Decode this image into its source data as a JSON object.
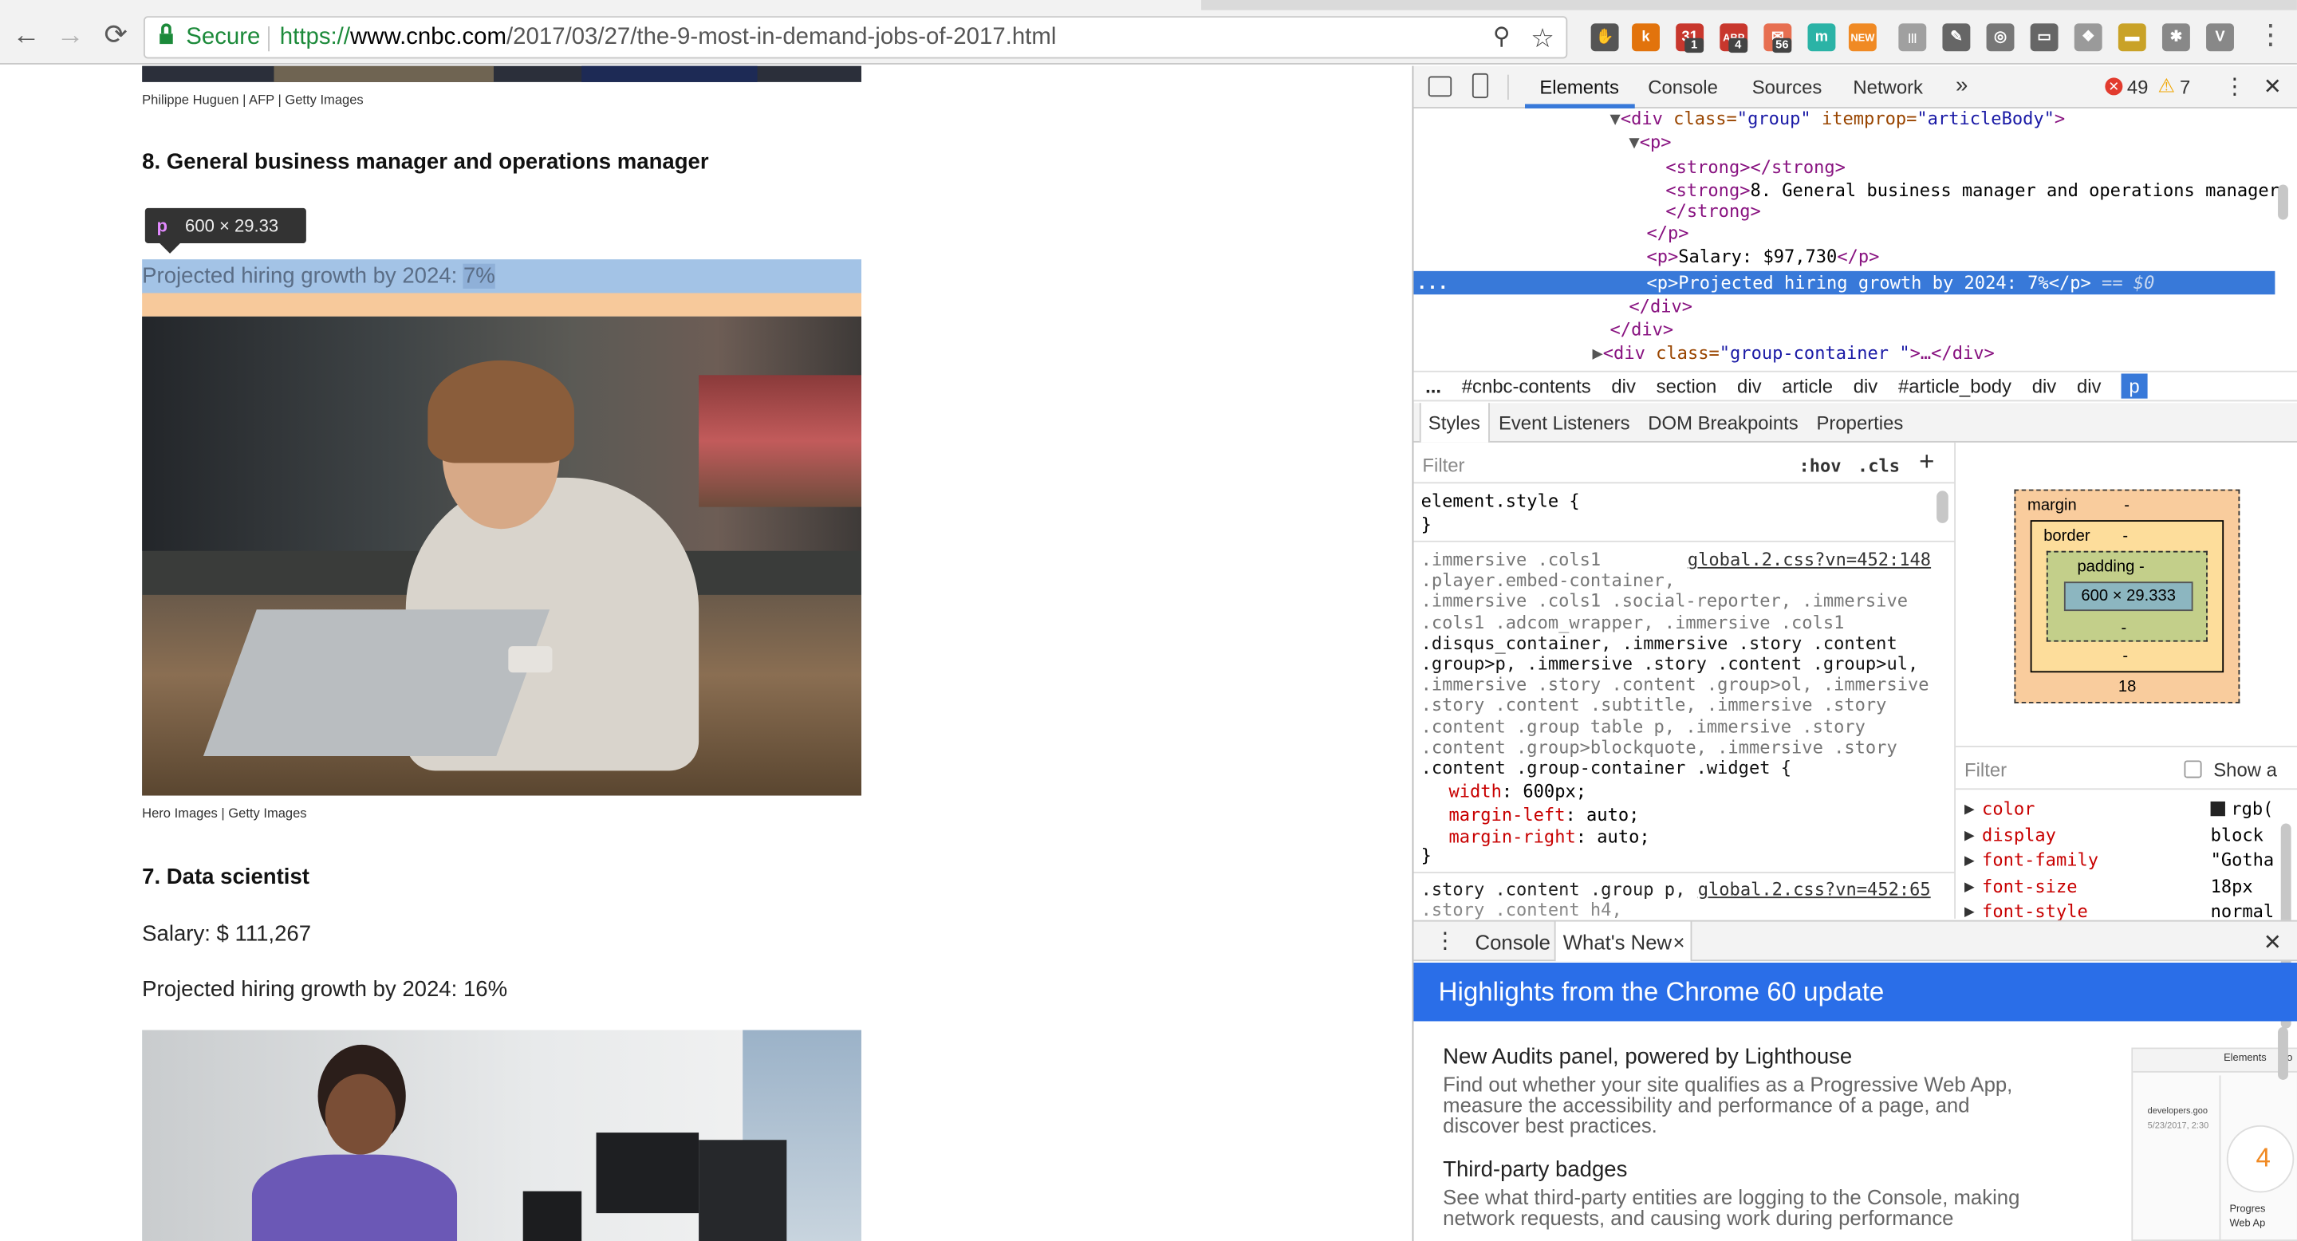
{
  "browser": {
    "nav": {
      "back": "←",
      "forward": "→",
      "reload": "⟳"
    },
    "secure_label": "Secure",
    "url": {
      "scheme": "https://",
      "host": "www.cnbc.com",
      "path": "/2017/03/27/the-9-most-in-demand-jobs-of-2017.html"
    },
    "omnibox_icons": {
      "zoom": "⚲",
      "star": "☆"
    },
    "extensions": [
      {
        "name": "ext-hand",
        "glyph": "✋",
        "color": "#555555",
        "badge": ""
      },
      {
        "name": "ext-k",
        "glyph": "k",
        "color": "#e2730c",
        "badge": ""
      },
      {
        "name": "ext-calendar",
        "glyph": "31",
        "color": "#c8372d",
        "badge": "1"
      },
      {
        "name": "ext-adblock",
        "glyph": "ABP",
        "color": "#c8372d",
        "badge": "4"
      },
      {
        "name": "ext-mail",
        "glyph": "✉",
        "color": "#e76f51",
        "badge": "56"
      },
      {
        "name": "ext-m",
        "glyph": "m",
        "color": "#2bb3a6",
        "badge": ""
      },
      {
        "name": "ext-new",
        "glyph": "NEW",
        "color": "#f08a24",
        "badge": ""
      },
      {
        "name": "ext-books",
        "glyph": "|||",
        "color": "#a0a0a0",
        "badge": ""
      },
      {
        "name": "ext-eyedropper",
        "glyph": "✎",
        "color": "#666666",
        "badge": ""
      },
      {
        "name": "ext-globe",
        "glyph": "◎",
        "color": "#777777",
        "badge": ""
      },
      {
        "name": "ext-cast",
        "glyph": "▭",
        "color": "#666666",
        "badge": ""
      },
      {
        "name": "ext-dropbox",
        "glyph": "❖",
        "color": "#9a9a9a",
        "badge": ""
      },
      {
        "name": "ext-burger",
        "glyph": "▬",
        "color": "#c9a227",
        "badge": ""
      },
      {
        "name": "ext-gear",
        "glyph": "✱",
        "color": "#888888",
        "badge": ""
      },
      {
        "name": "ext-v",
        "glyph": "V",
        "color": "#888888",
        "badge": ""
      }
    ],
    "menu_glyph": "⋮"
  },
  "page": {
    "caption_top": "Philippe Huguen | AFP | Getty Images",
    "heading_8": "8. General business manager and operations manager",
    "tooltip": {
      "tag": "p",
      "size": "600 × 29.33"
    },
    "growth_8_prefix": "Projected hiring growth by 2024: ",
    "growth_8_value": "7%",
    "caption_mid": "Hero Images | Getty Images",
    "heading_7": "7. Data scientist",
    "salary_7": "Salary: $ 111,267",
    "growth_7": "Projected hiring growth by 2024: 16%"
  },
  "devtools": {
    "tabs": [
      "Elements",
      "Console",
      "Sources",
      "Network"
    ],
    "more_tabs": "»",
    "errors": "49",
    "warnings": "7",
    "menu": "⋮",
    "close": "✕",
    "elements": {
      "lines": [
        {
          "indent": 145,
          "twisty": "▼",
          "html": "div-group"
        },
        {
          "indent": 159,
          "twisty": "▼",
          "html": "p-open"
        }
      ],
      "l1_tag": "<div ",
      "l1_attr1": "class=",
      "l1_val1": "\"group\"",
      "l1_attr2": " itemprop=",
      "l1_val2": "\"articleBody\"",
      "l1_end": ">",
      "l2": "<p>",
      "l3": "<strong></strong>",
      "l4_tag": "<strong>",
      "l4_text": "8. General business manager and operations manager",
      "l5": "</strong>",
      "l6": "</p>",
      "l7_tag": "<p>",
      "l7_text": "Salary: $97,730",
      "l7_end": "</p>",
      "l8_text": "<p>Projected hiring growth by 2024: 7%</p>",
      "l8_suffix": " == $0",
      "l8_dots": "...",
      "l9": "</div>",
      "l10": "</div>",
      "l11_tag": "<div ",
      "l11_attr": "class=",
      "l11_val": "\"group-container \"",
      "l11_end": ">…</div>"
    },
    "breadcrumbs": [
      "...",
      "#cnbc-contents",
      "div",
      "section",
      "div",
      "article",
      "div",
      "#article_body",
      "div",
      "div",
      "p"
    ],
    "style_tabs": [
      "Styles",
      "Event Listeners",
      "DOM Breakpoints",
      "Properties"
    ],
    "filter_placeholder": "Filter",
    "hov": ":hov",
    "cls": ".cls",
    "plus": "+",
    "element_style": "element.style {",
    "close_brace": "}",
    "rule_link": "global.2.css?vn=452:148",
    "selectors": [
      ".immersive .cols1",
      ".player.embed-container,",
      ".immersive .cols1 .social-reporter, .immersive",
      ".cols1 .adcom_wrapper, .immersive .cols1",
      ".disqus_container, .immersive .story .content",
      ".group>p, .immersive .story .content .group>ul,",
      ".immersive .story .content .group>ol, .immersive",
      ".story .content .subtitle, .immersive .story",
      ".content .group table p, .immersive .story",
      ".content .group>blockquote, .immersive .story",
      ".content .group-container .widget {"
    ],
    "declarations": [
      {
        "prop": "width",
        "val": "600px;"
      },
      {
        "prop": "margin-left",
        "val": "auto;"
      },
      {
        "prop": "margin-right",
        "val": "auto;"
      }
    ],
    "rule2_selector": ".story .content .group p,",
    "rule2_link": "global.2.css?vn=452:65",
    "rule2_next": ".story .content h4,",
    "boxmodel": {
      "margin": "margin",
      "border": "border",
      "padding": "padding -",
      "content": "600 × 29.333",
      "dash": "-",
      "bottom_margin": "18"
    },
    "computed_filter": "Filter",
    "show_all": "Show a",
    "computed": [
      {
        "prop": "color",
        "val": "rgb("
      },
      {
        "prop": "display",
        "val": "block"
      },
      {
        "prop": "font-family",
        "val": "\"Gotha"
      },
      {
        "prop": "font-size",
        "val": "18px"
      },
      {
        "prop": "font-style",
        "val": "normal"
      }
    ],
    "drawer": {
      "menu": "⋮",
      "tabs": [
        "Console",
        "What's New"
      ],
      "tab_close": "×",
      "close": "✕",
      "banner": "Highlights from the Chrome 60 update",
      "items": [
        {
          "title": "New Audits panel, powered by Lighthouse",
          "desc": [
            "Find out whether your site qualifies as a Progressive Web App,",
            "measure the accessibility and performance of a page, and",
            "discover best practices."
          ]
        },
        {
          "title": "Third-party badges",
          "desc": [
            "See what third-party entities are logging to the Console, making",
            "network requests, and causing work during performance"
          ]
        }
      ],
      "thumb": {
        "tab": "Elements",
        "tab2": "Co",
        "site": "developers.goo",
        "date": "5/23/2017, 2:30",
        "score": "4",
        "label1": "Progres",
        "label2": "Web Ap"
      }
    }
  }
}
